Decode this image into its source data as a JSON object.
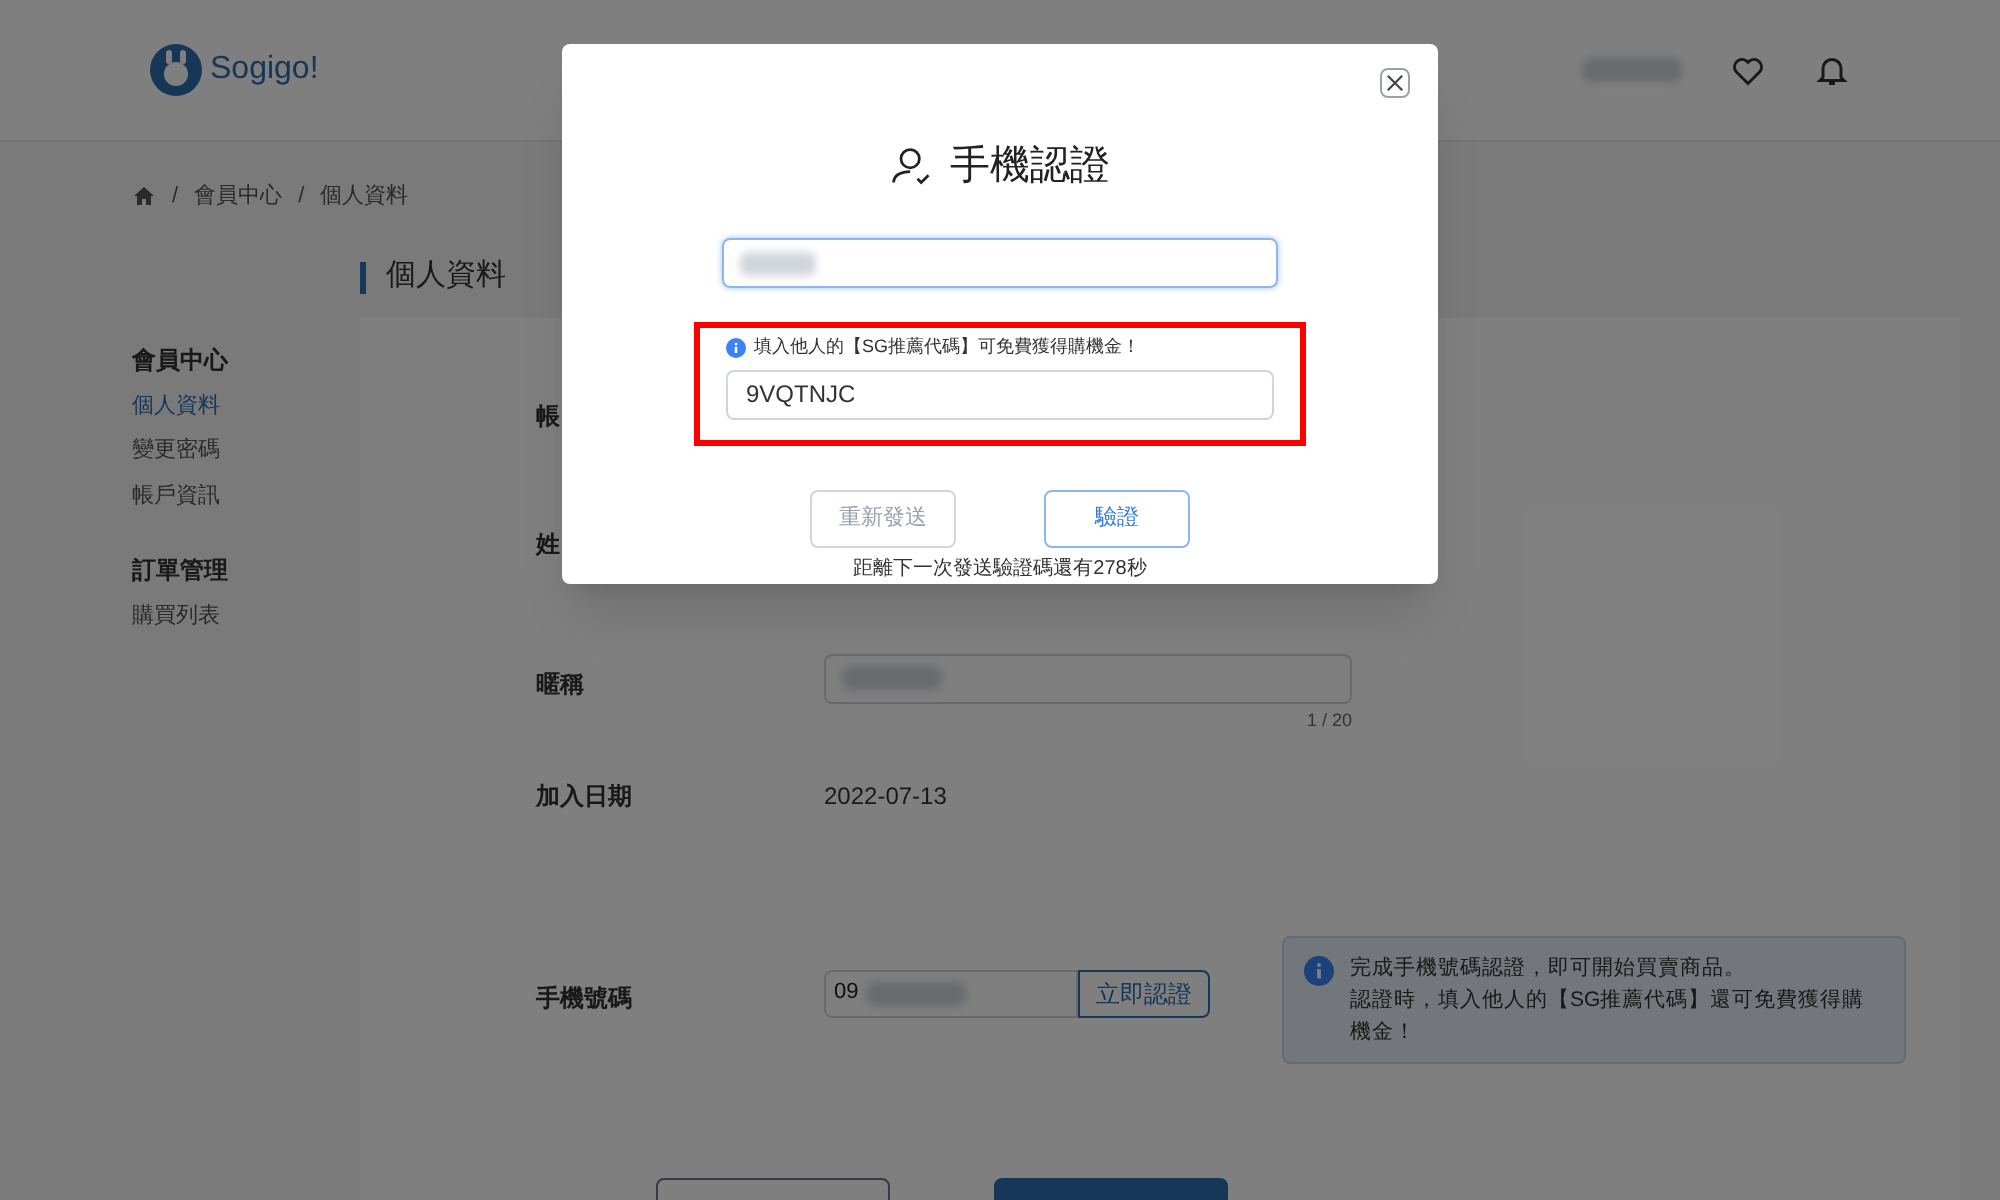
{
  "header": {
    "logo": "Sogigo!"
  },
  "breadcrumb": {
    "separator": "/",
    "items": [
      "會員中心",
      "個人資料"
    ]
  },
  "page_title": "個人資料",
  "sidebar": [
    {
      "title": "會員中心",
      "items": [
        {
          "label": "個人資料",
          "selected": true
        },
        {
          "label": "變更密碼",
          "selected": false
        },
        {
          "label": "帳戶資訊",
          "selected": false
        }
      ]
    },
    {
      "title": "訂單管理",
      "items": [
        {
          "label": "購買列表",
          "selected": false
        }
      ]
    }
  ],
  "form": [
    {
      "kind": "label_only",
      "label": "帳"
    },
    {
      "kind": "label_only",
      "label": "姓"
    },
    {
      "kind": "text_input",
      "label": "暱稱",
      "counter": "1 / 20"
    },
    {
      "kind": "text",
      "label": "加入日期",
      "value": "2022-07-13"
    },
    {
      "kind": "phone",
      "label": "手機號碼",
      "value": "09",
      "button": "立即認證",
      "notice": [
        "完成手機號碼認證，即可開始買賣商品。",
        "認證時，填入他人的【SG推薦代碼】還可免費獲得購機金！"
      ]
    }
  ],
  "modal": {
    "title": "手機認證",
    "referral": {
      "hint": "填入他人的【SG推薦代碼】可免費獲得購機金！",
      "value": "9VQTNJC",
      "highlighted": true
    },
    "buttons": [
      {
        "label": "重新發送",
        "disabled": true
      },
      {
        "label": "驗證",
        "disabled": false
      }
    ],
    "countdown": "距離下一次發送驗證碼還有278秒"
  }
}
